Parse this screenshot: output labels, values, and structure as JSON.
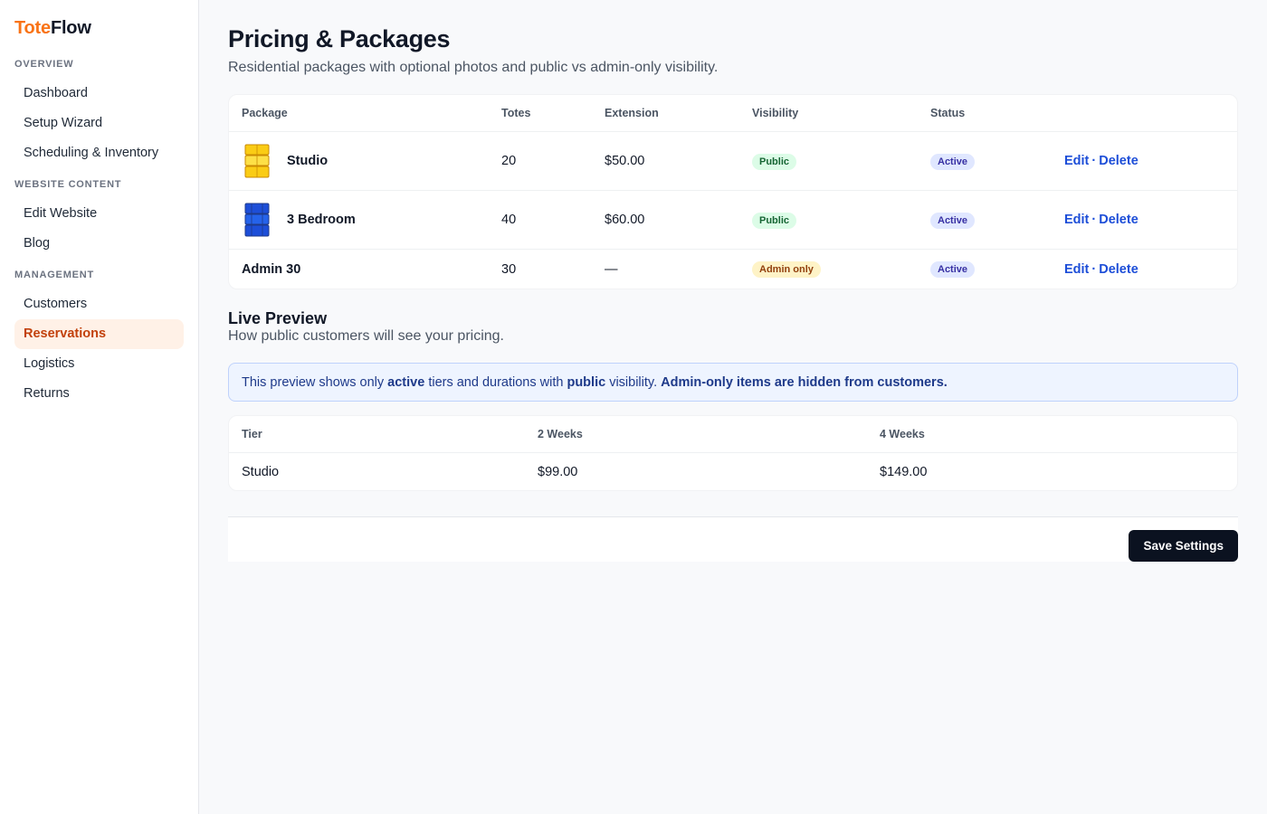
{
  "brand": {
    "part1": "Tote",
    "part2": "Flow"
  },
  "sidebar": {
    "sections": [
      {
        "title": "OVERVIEW",
        "items": [
          "Dashboard",
          "Setup Wizard",
          "Scheduling & Inventory"
        ]
      },
      {
        "title": "WEBSITE CONTENT",
        "items": [
          "Edit Website",
          "Blog"
        ]
      },
      {
        "title": "MANAGEMENT",
        "items": [
          "Customers",
          "Reservations",
          "Logistics",
          "Returns"
        ]
      }
    ],
    "active_item": "Reservations"
  },
  "page": {
    "title": "Pricing & Packages",
    "subtitle": "Residential packages with optional photos and public vs admin-only visibility."
  },
  "packages": {
    "headers": {
      "package": "Package",
      "totes": "Totes",
      "extension": "Extension",
      "visibility": "Visibility",
      "status": "Status"
    },
    "rows": [
      {
        "name": "Studio",
        "totes": "20",
        "extension": "$50.00",
        "visibility": "Public",
        "status": "Active",
        "edit": "Edit",
        "sep": "·",
        "delete": "Delete",
        "thumb_color": "#facc15"
      },
      {
        "name": "3 Bedroom",
        "totes": "40",
        "extension": "$60.00",
        "visibility": "Public",
        "status": "Active",
        "edit": "Edit",
        "sep": "·",
        "delete": "Delete",
        "thumb_color": "#1d4ed8"
      },
      {
        "name": "Admin 30",
        "totes": "30",
        "extension": "—",
        "visibility": "Admin only",
        "status": "Active",
        "edit": "Edit",
        "sep": "·",
        "delete": "Delete"
      }
    ]
  },
  "preview": {
    "title": "Live Preview",
    "subtitle": "How public customers will see your pricing.",
    "notice": {
      "t1": "This preview shows only ",
      "b1": "active",
      "t2": " tiers and durations with ",
      "b2": "public",
      "t3": " visibility. ",
      "b3": "Admin-only items are hidden from customers."
    },
    "headers": {
      "tier": "Tier",
      "w2": "2 Weeks",
      "w4": "4 Weeks"
    },
    "rows": [
      {
        "tier": "Studio",
        "w2": "$99.00",
        "w4": "$149.00"
      }
    ]
  },
  "footer": {
    "save_label": "Save Settings"
  },
  "colors": {
    "accent": "#f97316",
    "active_nav_bg": "#fff1e7",
    "link": "#1d4ed8",
    "primary_button": "#0b1220"
  }
}
